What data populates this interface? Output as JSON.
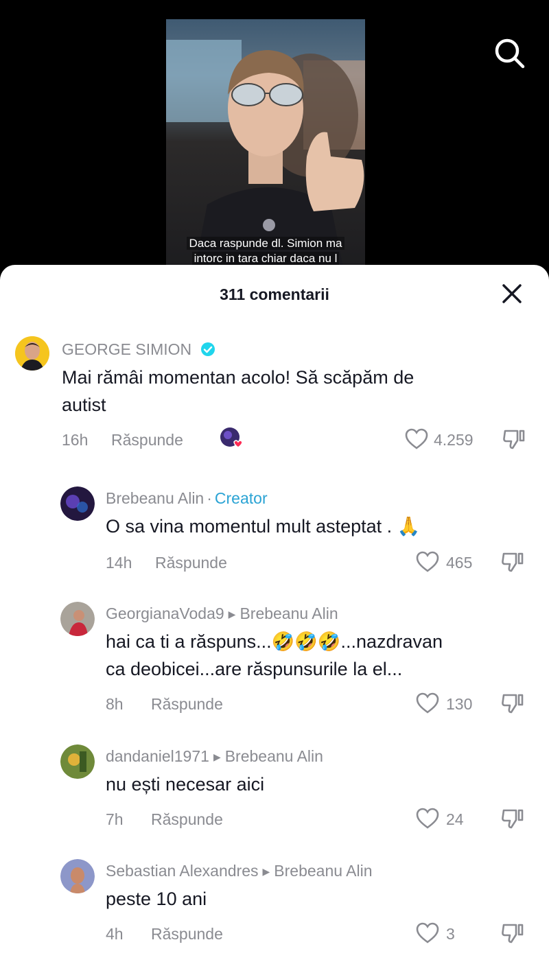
{
  "video": {
    "caption_line1": "Daca raspunde dl. Simion ma",
    "caption_line2": "intorc in tara chiar daca nu l"
  },
  "header": {
    "comment_count": "311 comentarii",
    "search_icon": "search-icon",
    "close_icon": "close-icon"
  },
  "comments": [
    {
      "author": "GEORGE SIMION",
      "verified": true,
      "text_line1": "Mai rămâi momentan acolo! Să scăpăm de",
      "text_line2": "autist",
      "time": "16h",
      "reply": "Răspunde",
      "likes": "4.259",
      "creator_reacted": true
    },
    {
      "author": "Brebeanu Alin",
      "badge_separator": "·",
      "badge": "Creator",
      "text_line1": "O sa vina momentul mult asteptat . 🙏",
      "time": "14h",
      "reply": "Răspunde",
      "likes": "465"
    },
    {
      "author": "GeorgianaVoda9",
      "reply_to": "Brebeanu Alin",
      "text_line1": "hai ca ti a răspuns...🤣🤣🤣...nazdravan",
      "text_line2": "ca deobicei...are răspunsurile la el...",
      "time": "8h",
      "reply": "Răspunde",
      "likes": "130"
    },
    {
      "author": "dandaniel1971",
      "reply_to": "Brebeanu Alin",
      "text_line1": "nu ești necesar aici",
      "time": "7h",
      "reply": "Răspunde",
      "likes": "24"
    },
    {
      "author": "Sebastian Alexandres",
      "reply_to": "Brebeanu Alin",
      "text_line1": "peste 10 ani",
      "time": "4h",
      "reply": "Răspunde",
      "likes": "3"
    }
  ],
  "colors": {
    "creator_badge": "#2aa3d4",
    "verified": "#20d5ec",
    "text_primary": "#161823",
    "text_secondary": "#8a8b91"
  }
}
